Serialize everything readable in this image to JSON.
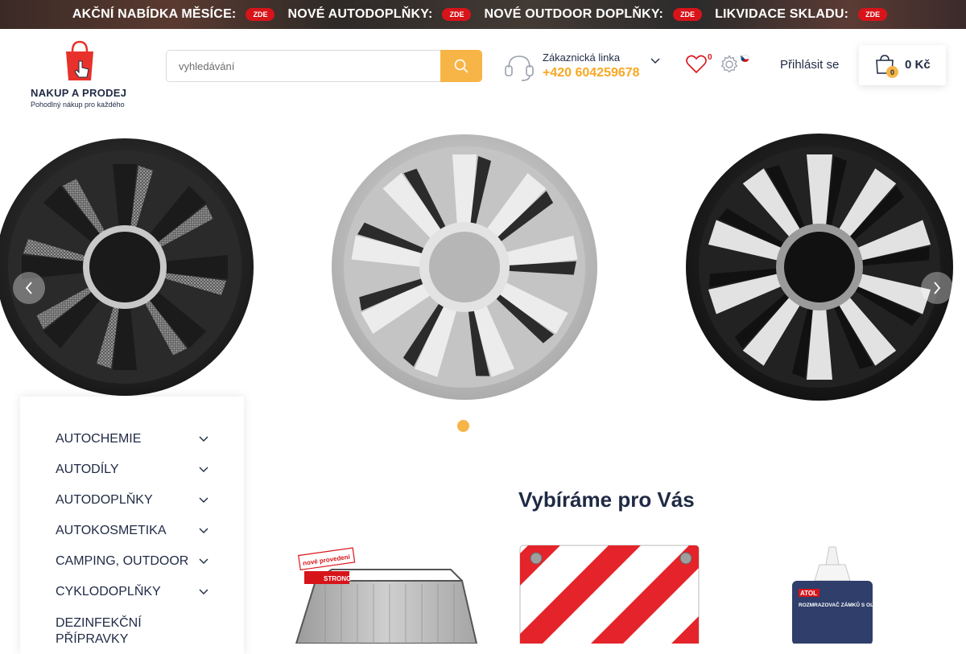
{
  "promo": {
    "items": [
      {
        "text": "AKČNÍ NABÍDKA MĚSÍCE:",
        "badge": "ZDE"
      },
      {
        "text": "NOVÉ AUTODOPLŇKY:",
        "badge": "ZDE"
      },
      {
        "text": "NOVÉ OUTDOOR DOPLŇKY:",
        "badge": "ZDE"
      },
      {
        "text": "LIKVIDACE SKLADU:",
        "badge": "ZDE"
      }
    ]
  },
  "logo": {
    "title": "NAKUP A PRODEJ",
    "subtitle": "Pohodlný nákup pro každého"
  },
  "search": {
    "placeholder": "vyhledávání"
  },
  "support": {
    "label": "Zákaznická linka",
    "phone": "+420 604259678"
  },
  "wishlist": {
    "count": "0"
  },
  "login": {
    "label": "Přihlásit se"
  },
  "cart": {
    "count": "0",
    "total": "0 Kč"
  },
  "categories": [
    {
      "label": "AUTOCHEMIE"
    },
    {
      "label": "AUTODÍLY"
    },
    {
      "label": "AUTODOPLŇKY"
    },
    {
      "label": "AUTOKOSMETIKA"
    },
    {
      "label": "CAMPING, OUTDOOR"
    },
    {
      "label": "CYKLODOPLŇKY"
    },
    {
      "label": "DEZINFEKČNÍ PŘÍPRAVKY"
    }
  ],
  "section": {
    "title": "Vybíráme pro Vás"
  },
  "products": [
    {
      "badge": "nové provedení",
      "sub": "STRONG"
    },
    {
      "badge": ""
    },
    {
      "brand": "ATOL",
      "label": "ROZMRAZOVAČ ZÁMKŮ S OLEJEM"
    }
  ],
  "colors": {
    "accent": "#f7b547",
    "phone": "#f7a823",
    "badge": "#d7141a",
    "text": "#1f2a44"
  }
}
